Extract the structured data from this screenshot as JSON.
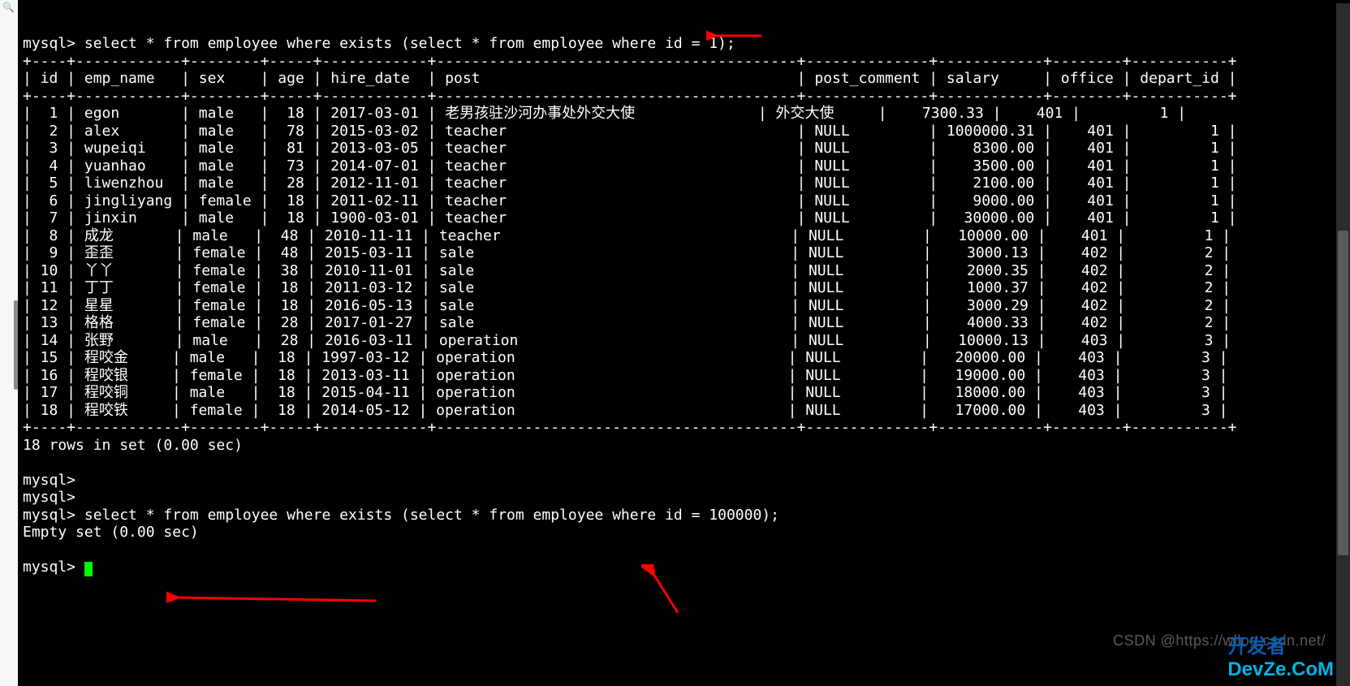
{
  "prompt": "mysql>",
  "query1": "select * from employee where exists (select * from employee where id = 1);",
  "query2": "select * from employee where exists (select * from employee where id = 100000);",
  "columns": [
    "id",
    "emp_name",
    "sex",
    "age",
    "hire_date",
    "post",
    "post_comment",
    "salary",
    "office",
    "depart_id"
  ],
  "rows": [
    {
      "id": 1,
      "emp_name": "egon",
      "sex": "male",
      "age": 18,
      "hire_date": "2017-03-01",
      "post": "老男孩驻沙河办事处外交大使",
      "post_comment": "外交大使",
      "salary": "7300.33",
      "office": 401,
      "depart_id": 1
    },
    {
      "id": 2,
      "emp_name": "alex",
      "sex": "male",
      "age": 78,
      "hire_date": "2015-03-02",
      "post": "teacher",
      "post_comment": "NULL",
      "salary": "1000000.31",
      "office": 401,
      "depart_id": 1
    },
    {
      "id": 3,
      "emp_name": "wupeiqi",
      "sex": "male",
      "age": 81,
      "hire_date": "2013-03-05",
      "post": "teacher",
      "post_comment": "NULL",
      "salary": "8300.00",
      "office": 401,
      "depart_id": 1
    },
    {
      "id": 4,
      "emp_name": "yuanhao",
      "sex": "male",
      "age": 73,
      "hire_date": "2014-07-01",
      "post": "teacher",
      "post_comment": "NULL",
      "salary": "3500.00",
      "office": 401,
      "depart_id": 1
    },
    {
      "id": 5,
      "emp_name": "liwenzhou",
      "sex": "male",
      "age": 28,
      "hire_date": "2012-11-01",
      "post": "teacher",
      "post_comment": "NULL",
      "salary": "2100.00",
      "office": 401,
      "depart_id": 1
    },
    {
      "id": 6,
      "emp_name": "jingliyang",
      "sex": "female",
      "age": 18,
      "hire_date": "2011-02-11",
      "post": "teacher",
      "post_comment": "NULL",
      "salary": "9000.00",
      "office": 401,
      "depart_id": 1
    },
    {
      "id": 7,
      "emp_name": "jinxin",
      "sex": "male",
      "age": 18,
      "hire_date": "1900-03-01",
      "post": "teacher",
      "post_comment": "NULL",
      "salary": "30000.00",
      "office": 401,
      "depart_id": 1
    },
    {
      "id": 8,
      "emp_name": "成龙",
      "sex": "male",
      "age": 48,
      "hire_date": "2010-11-11",
      "post": "teacher",
      "post_comment": "NULL",
      "salary": "10000.00",
      "office": 401,
      "depart_id": 1
    },
    {
      "id": 9,
      "emp_name": "歪歪",
      "sex": "female",
      "age": 48,
      "hire_date": "2015-03-11",
      "post": "sale",
      "post_comment": "NULL",
      "salary": "3000.13",
      "office": 402,
      "depart_id": 2
    },
    {
      "id": 10,
      "emp_name": "丫丫",
      "sex": "female",
      "age": 38,
      "hire_date": "2010-11-01",
      "post": "sale",
      "post_comment": "NULL",
      "salary": "2000.35",
      "office": 402,
      "depart_id": 2
    },
    {
      "id": 11,
      "emp_name": "丁丁",
      "sex": "female",
      "age": 18,
      "hire_date": "2011-03-12",
      "post": "sale",
      "post_comment": "NULL",
      "salary": "1000.37",
      "office": 402,
      "depart_id": 2
    },
    {
      "id": 12,
      "emp_name": "星星",
      "sex": "female",
      "age": 18,
      "hire_date": "2016-05-13",
      "post": "sale",
      "post_comment": "NULL",
      "salary": "3000.29",
      "office": 402,
      "depart_id": 2
    },
    {
      "id": 13,
      "emp_name": "格格",
      "sex": "female",
      "age": 28,
      "hire_date": "2017-01-27",
      "post": "sale",
      "post_comment": "NULL",
      "salary": "4000.33",
      "office": 402,
      "depart_id": 2
    },
    {
      "id": 14,
      "emp_name": "张野",
      "sex": "male",
      "age": 28,
      "hire_date": "2016-03-11",
      "post": "operation",
      "post_comment": "NULL",
      "salary": "10000.13",
      "office": 403,
      "depart_id": 3
    },
    {
      "id": 15,
      "emp_name": "程咬金",
      "sex": "male",
      "age": 18,
      "hire_date": "1997-03-12",
      "post": "operation",
      "post_comment": "NULL",
      "salary": "20000.00",
      "office": 403,
      "depart_id": 3
    },
    {
      "id": 16,
      "emp_name": "程咬银",
      "sex": "female",
      "age": 18,
      "hire_date": "2013-03-11",
      "post": "operation",
      "post_comment": "NULL",
      "salary": "19000.00",
      "office": 403,
      "depart_id": 3
    },
    {
      "id": 17,
      "emp_name": "程咬铜",
      "sex": "male",
      "age": 18,
      "hire_date": "2015-04-11",
      "post": "operation",
      "post_comment": "NULL",
      "salary": "18000.00",
      "office": 403,
      "depart_id": 3
    },
    {
      "id": 18,
      "emp_name": "程咬铁",
      "sex": "female",
      "age": 18,
      "hire_date": "2014-05-12",
      "post": "operation",
      "post_comment": "NULL",
      "salary": "17000.00",
      "office": 403,
      "depart_id": 3
    }
  ],
  "result_summary": "18 rows in set (0.00 sec)",
  "empty_result": "Empty set (0.00 sec)",
  "divider": "+----+------------+--------+-----+------------+-----------------------------------------+--------------+------------+--------+-----------+",
  "watermark1": "CSDN @https://wllog.csdn.net/",
  "watermark2_a": "开发者",
  "watermark2_b": "DevZe.CoM"
}
